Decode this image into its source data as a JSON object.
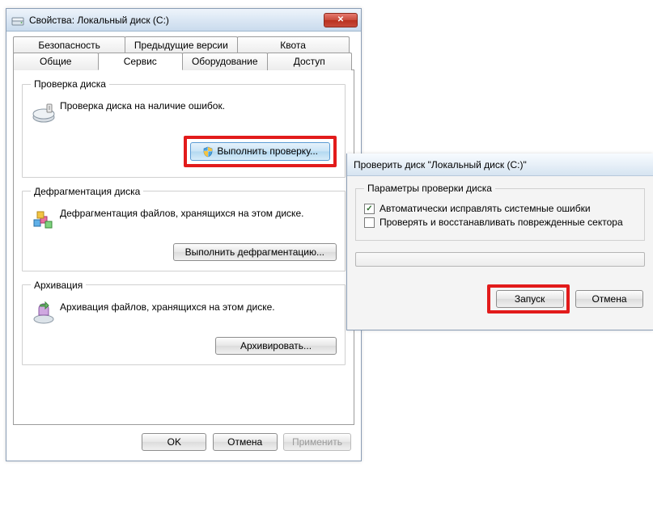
{
  "props": {
    "title": "Свойства: Локальный диск (C:)",
    "tabs_row1": [
      "Безопасность",
      "Предыдущие версии",
      "Квота"
    ],
    "tabs_row2": [
      "Общие",
      "Сервис",
      "Оборудование",
      "Доступ"
    ],
    "active_tab": "Сервис",
    "check": {
      "legend": "Проверка диска",
      "text": "Проверка диска на наличие ошибок.",
      "button": "Выполнить проверку..."
    },
    "defrag": {
      "legend": "Дефрагментация диска",
      "text": "Дефрагментация файлов, хранящихся на этом диске.",
      "button": "Выполнить дефрагментацию..."
    },
    "backup": {
      "legend": "Архивация",
      "text": "Архивация файлов, хранящихся на этом диске.",
      "button": "Архивировать..."
    },
    "ok": "OK",
    "cancel": "Отмена",
    "apply": "Применить"
  },
  "checkdisk": {
    "title": "Проверить диск \"Локальный диск (C:)\"",
    "legend": "Параметры проверки диска",
    "opt1": "Автоматически исправлять системные ошибки",
    "opt2": "Проверять и восстанавливать поврежденные сектора",
    "opt1_checked": true,
    "opt2_checked": false,
    "start": "Запуск",
    "cancel": "Отмена"
  }
}
